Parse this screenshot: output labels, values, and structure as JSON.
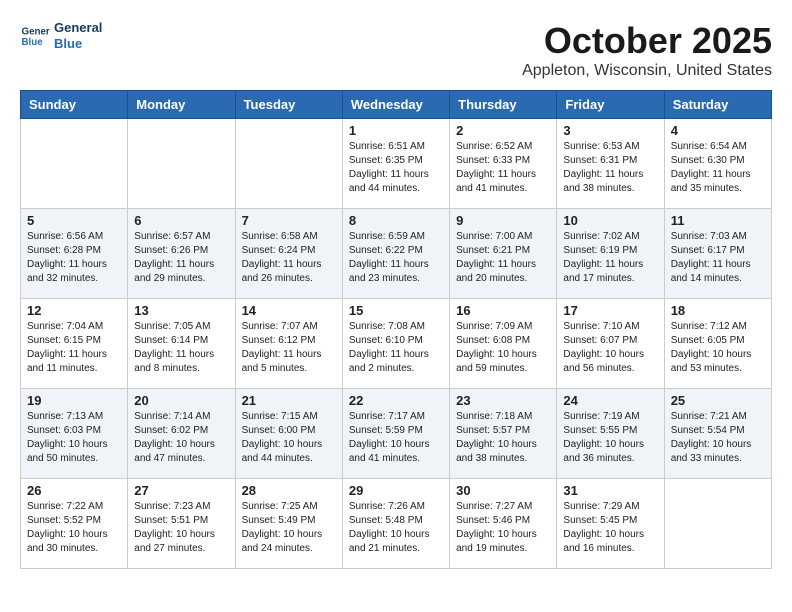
{
  "header": {
    "logo_line1": "General",
    "logo_line2": "Blue",
    "month": "October 2025",
    "location": "Appleton, Wisconsin, United States"
  },
  "weekdays": [
    "Sunday",
    "Monday",
    "Tuesday",
    "Wednesday",
    "Thursday",
    "Friday",
    "Saturday"
  ],
  "weeks": [
    [
      {
        "day": "",
        "info": ""
      },
      {
        "day": "",
        "info": ""
      },
      {
        "day": "",
        "info": ""
      },
      {
        "day": "1",
        "info": "Sunrise: 6:51 AM\nSunset: 6:35 PM\nDaylight: 11 hours\nand 44 minutes."
      },
      {
        "day": "2",
        "info": "Sunrise: 6:52 AM\nSunset: 6:33 PM\nDaylight: 11 hours\nand 41 minutes."
      },
      {
        "day": "3",
        "info": "Sunrise: 6:53 AM\nSunset: 6:31 PM\nDaylight: 11 hours\nand 38 minutes."
      },
      {
        "day": "4",
        "info": "Sunrise: 6:54 AM\nSunset: 6:30 PM\nDaylight: 11 hours\nand 35 minutes."
      }
    ],
    [
      {
        "day": "5",
        "info": "Sunrise: 6:56 AM\nSunset: 6:28 PM\nDaylight: 11 hours\nand 32 minutes."
      },
      {
        "day": "6",
        "info": "Sunrise: 6:57 AM\nSunset: 6:26 PM\nDaylight: 11 hours\nand 29 minutes."
      },
      {
        "day": "7",
        "info": "Sunrise: 6:58 AM\nSunset: 6:24 PM\nDaylight: 11 hours\nand 26 minutes."
      },
      {
        "day": "8",
        "info": "Sunrise: 6:59 AM\nSunset: 6:22 PM\nDaylight: 11 hours\nand 23 minutes."
      },
      {
        "day": "9",
        "info": "Sunrise: 7:00 AM\nSunset: 6:21 PM\nDaylight: 11 hours\nand 20 minutes."
      },
      {
        "day": "10",
        "info": "Sunrise: 7:02 AM\nSunset: 6:19 PM\nDaylight: 11 hours\nand 17 minutes."
      },
      {
        "day": "11",
        "info": "Sunrise: 7:03 AM\nSunset: 6:17 PM\nDaylight: 11 hours\nand 14 minutes."
      }
    ],
    [
      {
        "day": "12",
        "info": "Sunrise: 7:04 AM\nSunset: 6:15 PM\nDaylight: 11 hours\nand 11 minutes."
      },
      {
        "day": "13",
        "info": "Sunrise: 7:05 AM\nSunset: 6:14 PM\nDaylight: 11 hours\nand 8 minutes."
      },
      {
        "day": "14",
        "info": "Sunrise: 7:07 AM\nSunset: 6:12 PM\nDaylight: 11 hours\nand 5 minutes."
      },
      {
        "day": "15",
        "info": "Sunrise: 7:08 AM\nSunset: 6:10 PM\nDaylight: 11 hours\nand 2 minutes."
      },
      {
        "day": "16",
        "info": "Sunrise: 7:09 AM\nSunset: 6:08 PM\nDaylight: 10 hours\nand 59 minutes."
      },
      {
        "day": "17",
        "info": "Sunrise: 7:10 AM\nSunset: 6:07 PM\nDaylight: 10 hours\nand 56 minutes."
      },
      {
        "day": "18",
        "info": "Sunrise: 7:12 AM\nSunset: 6:05 PM\nDaylight: 10 hours\nand 53 minutes."
      }
    ],
    [
      {
        "day": "19",
        "info": "Sunrise: 7:13 AM\nSunset: 6:03 PM\nDaylight: 10 hours\nand 50 minutes."
      },
      {
        "day": "20",
        "info": "Sunrise: 7:14 AM\nSunset: 6:02 PM\nDaylight: 10 hours\nand 47 minutes."
      },
      {
        "day": "21",
        "info": "Sunrise: 7:15 AM\nSunset: 6:00 PM\nDaylight: 10 hours\nand 44 minutes."
      },
      {
        "day": "22",
        "info": "Sunrise: 7:17 AM\nSunset: 5:59 PM\nDaylight: 10 hours\nand 41 minutes."
      },
      {
        "day": "23",
        "info": "Sunrise: 7:18 AM\nSunset: 5:57 PM\nDaylight: 10 hours\nand 38 minutes."
      },
      {
        "day": "24",
        "info": "Sunrise: 7:19 AM\nSunset: 5:55 PM\nDaylight: 10 hours\nand 36 minutes."
      },
      {
        "day": "25",
        "info": "Sunrise: 7:21 AM\nSunset: 5:54 PM\nDaylight: 10 hours\nand 33 minutes."
      }
    ],
    [
      {
        "day": "26",
        "info": "Sunrise: 7:22 AM\nSunset: 5:52 PM\nDaylight: 10 hours\nand 30 minutes."
      },
      {
        "day": "27",
        "info": "Sunrise: 7:23 AM\nSunset: 5:51 PM\nDaylight: 10 hours\nand 27 minutes."
      },
      {
        "day": "28",
        "info": "Sunrise: 7:25 AM\nSunset: 5:49 PM\nDaylight: 10 hours\nand 24 minutes."
      },
      {
        "day": "29",
        "info": "Sunrise: 7:26 AM\nSunset: 5:48 PM\nDaylight: 10 hours\nand 21 minutes."
      },
      {
        "day": "30",
        "info": "Sunrise: 7:27 AM\nSunset: 5:46 PM\nDaylight: 10 hours\nand 19 minutes."
      },
      {
        "day": "31",
        "info": "Sunrise: 7:29 AM\nSunset: 5:45 PM\nDaylight: 10 hours\nand 16 minutes."
      },
      {
        "day": "",
        "info": ""
      }
    ]
  ]
}
